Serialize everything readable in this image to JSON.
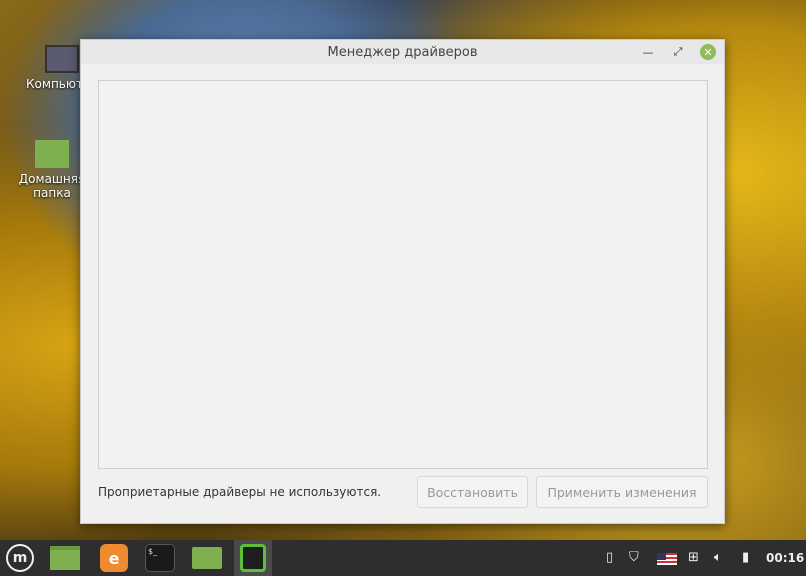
{
  "desktop": {
    "icons": [
      {
        "label": "Компьютер"
      },
      {
        "label": "Домашняя папка"
      }
    ]
  },
  "window": {
    "title": "Менеджер драйверов",
    "status": "Проприетарные драйверы не используются.",
    "revert_label": "Восстановить",
    "apply_label": "Применить изменения"
  },
  "taskbar": {
    "clock": "00:16",
    "apps": [
      "menu-icon",
      "files-icon",
      "firefox-icon",
      "terminal-icon",
      "folder-icon",
      "driver-manager-icon"
    ],
    "accent": "#8fbb5a"
  }
}
